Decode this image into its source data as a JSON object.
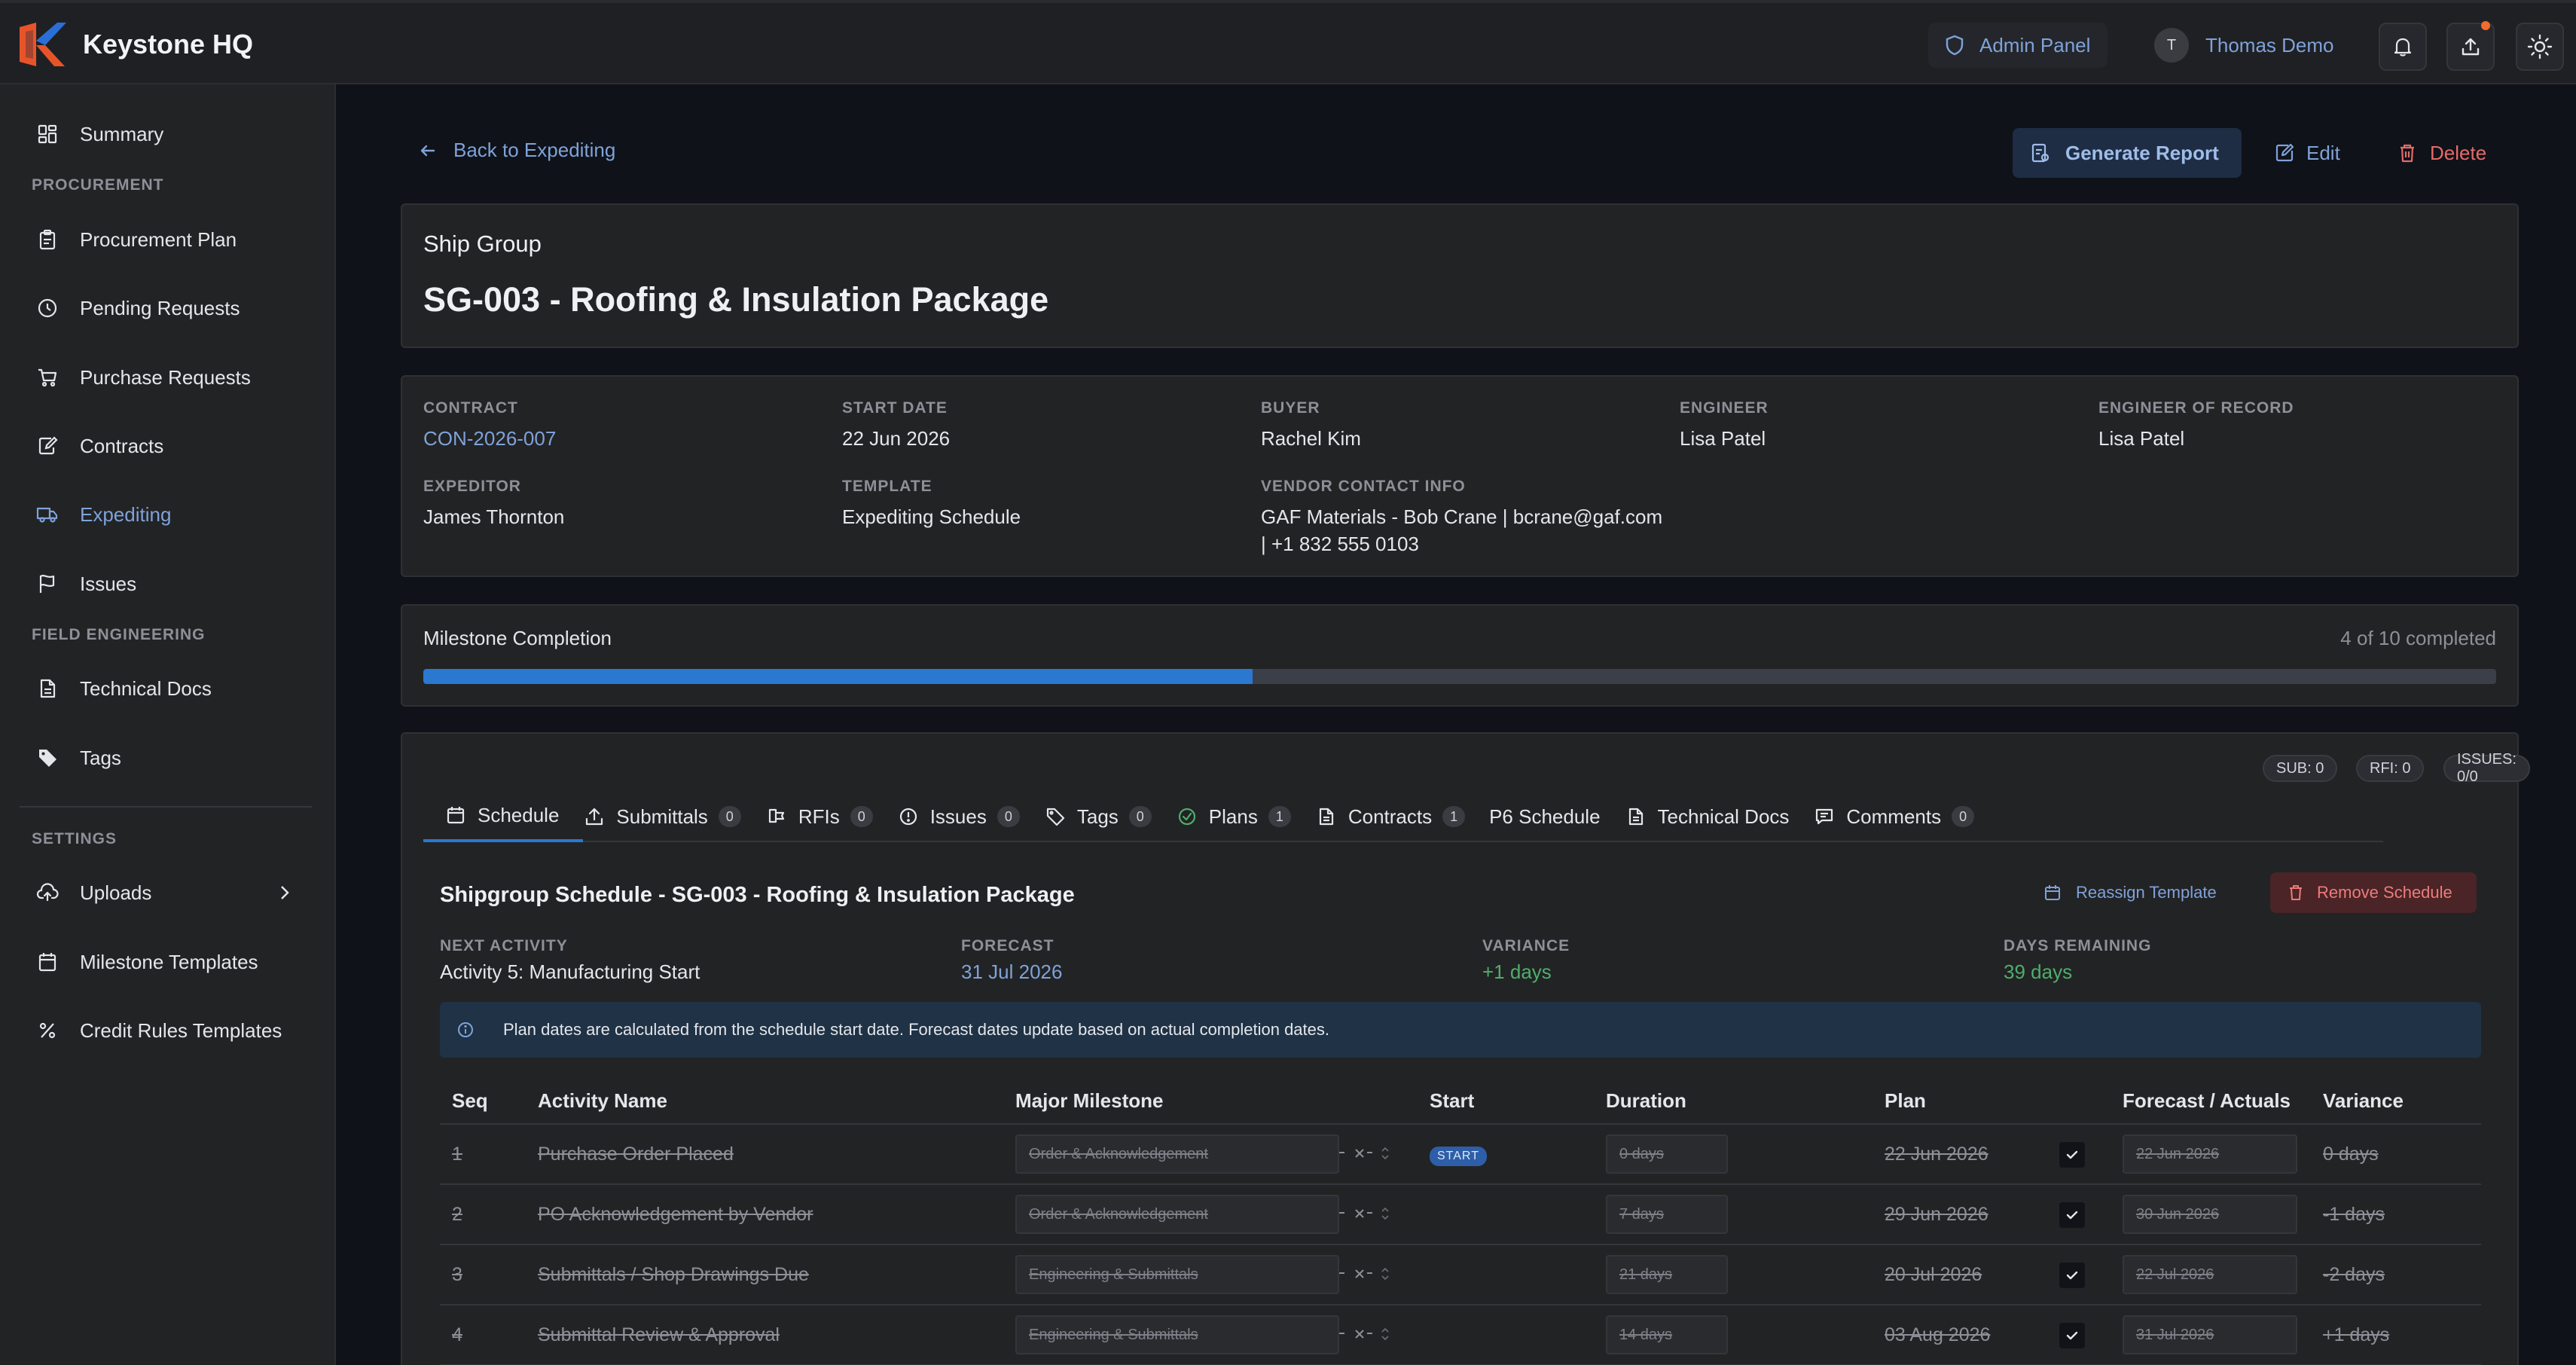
{
  "app": {
    "name": "Keystone HQ"
  },
  "header": {
    "admin_label": "Admin Panel",
    "user_initial": "T",
    "user_name": "Thomas Demo"
  },
  "sidebar": {
    "summary": "Summary",
    "section_procurement": "PROCUREMENT",
    "procurement_plan": "Procurement Plan",
    "pending_requests": "Pending Requests",
    "purchase_requests": "Purchase Requests",
    "contracts": "Contracts",
    "expediting": "Expediting",
    "issues": "Issues",
    "section_field": "FIELD ENGINEERING",
    "technical_docs": "Technical Docs",
    "tags": "Tags",
    "section_settings": "SETTINGS",
    "uploads": "Uploads",
    "milestone_templates": "Milestone Templates",
    "credit_rules": "Credit Rules Templates"
  },
  "page": {
    "back_label": "Back to Expediting",
    "generate_report": "Generate Report",
    "edit": "Edit",
    "delete": "Delete",
    "kind": "Ship Group",
    "title": "SG-003 - Roofing & Insulation Package"
  },
  "details": {
    "contract_label": "CONTRACT",
    "contract_value": "CON-2026-007",
    "start_date_label": "START DATE",
    "start_date_value": "22 Jun 2026",
    "buyer_label": "BUYER",
    "buyer_value": "Rachel Kim",
    "engineer_label": "ENGINEER",
    "engineer_value": "Lisa Patel",
    "eor_label": "ENGINEER OF RECORD",
    "eor_value": "Lisa Patel",
    "expeditor_label": "EXPEDITOR",
    "expeditor_value": "James Thornton",
    "template_label": "TEMPLATE",
    "template_value": "Expediting Schedule",
    "vendor_label": "VENDOR CONTACT INFO",
    "vendor_line1": "GAF Materials - Bob Crane | bcrane@gaf.com",
    "vendor_line2": "| +1 832 555 0103"
  },
  "milestone": {
    "label": "Milestone Completion",
    "summary": "4 of 10 completed",
    "completed": 4,
    "total": 10
  },
  "counters": {
    "sub": "SUB: 0",
    "rfi": "RFI: 0",
    "issues": "ISSUES: 0/0"
  },
  "tabs": [
    {
      "label": "Schedule",
      "badge": ""
    },
    {
      "label": "Submittals",
      "badge": "0"
    },
    {
      "label": "RFIs",
      "badge": "0"
    },
    {
      "label": "Issues",
      "badge": "0"
    },
    {
      "label": "Tags",
      "badge": "0"
    },
    {
      "label": "Plans",
      "badge": "1"
    },
    {
      "label": "Contracts",
      "badge": "1"
    },
    {
      "label": "P6 Schedule",
      "badge": ""
    },
    {
      "label": "Technical Docs",
      "badge": ""
    },
    {
      "label": "Comments",
      "badge": "0"
    }
  ],
  "schedule": {
    "title": "Shipgroup Schedule - SG-003 - Roofing & Insulation Package",
    "reassign": "Reassign Template",
    "remove": "Remove Schedule",
    "next_label": "NEXT ACTIVITY",
    "next_value": "Activity 5: Manufacturing Start",
    "forecast_label": "FORECAST",
    "forecast_value": "31 Jul 2026",
    "variance_label": "VARIANCE",
    "variance_value": "+1 days",
    "remaining_label": "DAYS REMAINING",
    "remaining_value": "39 days",
    "info": "Plan dates are calculated from the schedule start date. Forecast dates update based on actual completion dates.",
    "columns": {
      "seq": "Seq",
      "activity": "Activity Name",
      "milestone": "Major Milestone",
      "start": "Start",
      "duration": "Duration",
      "plan": "Plan",
      "forecast": "Forecast / Actuals",
      "variance": "Variance"
    },
    "start_badge": "START",
    "rows": [
      {
        "seq": "1",
        "activity": "Purchase Order Placed",
        "milestone": "Order & Acknowledgement",
        "duration": "0 days",
        "plan": "22 Jun 2026",
        "forecast": "22 Jun 2026",
        "variance": "0 days"
      },
      {
        "seq": "2",
        "activity": "PO Acknowledgement by Vendor",
        "milestone": "Order & Acknowledgement",
        "duration": "7 days",
        "plan": "29 Jun 2026",
        "forecast": "30 Jun 2026",
        "variance": "-1 days"
      },
      {
        "seq": "3",
        "activity": "Submittals / Shop Drawings Due",
        "milestone": "Engineering & Submittals",
        "duration": "21 days",
        "plan": "20 Jul 2026",
        "forecast": "22 Jul 2026",
        "variance": "-2 days"
      },
      {
        "seq": "4",
        "activity": "Submittal Review & Approval",
        "milestone": "Engineering & Submittals",
        "duration": "14 days",
        "plan": "03 Aug 2026",
        "forecast": "31 Jul 2026",
        "variance": "+1 days"
      }
    ]
  },
  "colors": {
    "accent": "#7fa2d9",
    "progress": "#2a78d0",
    "danger": "#e46a6a",
    "success": "#4fae6a"
  }
}
